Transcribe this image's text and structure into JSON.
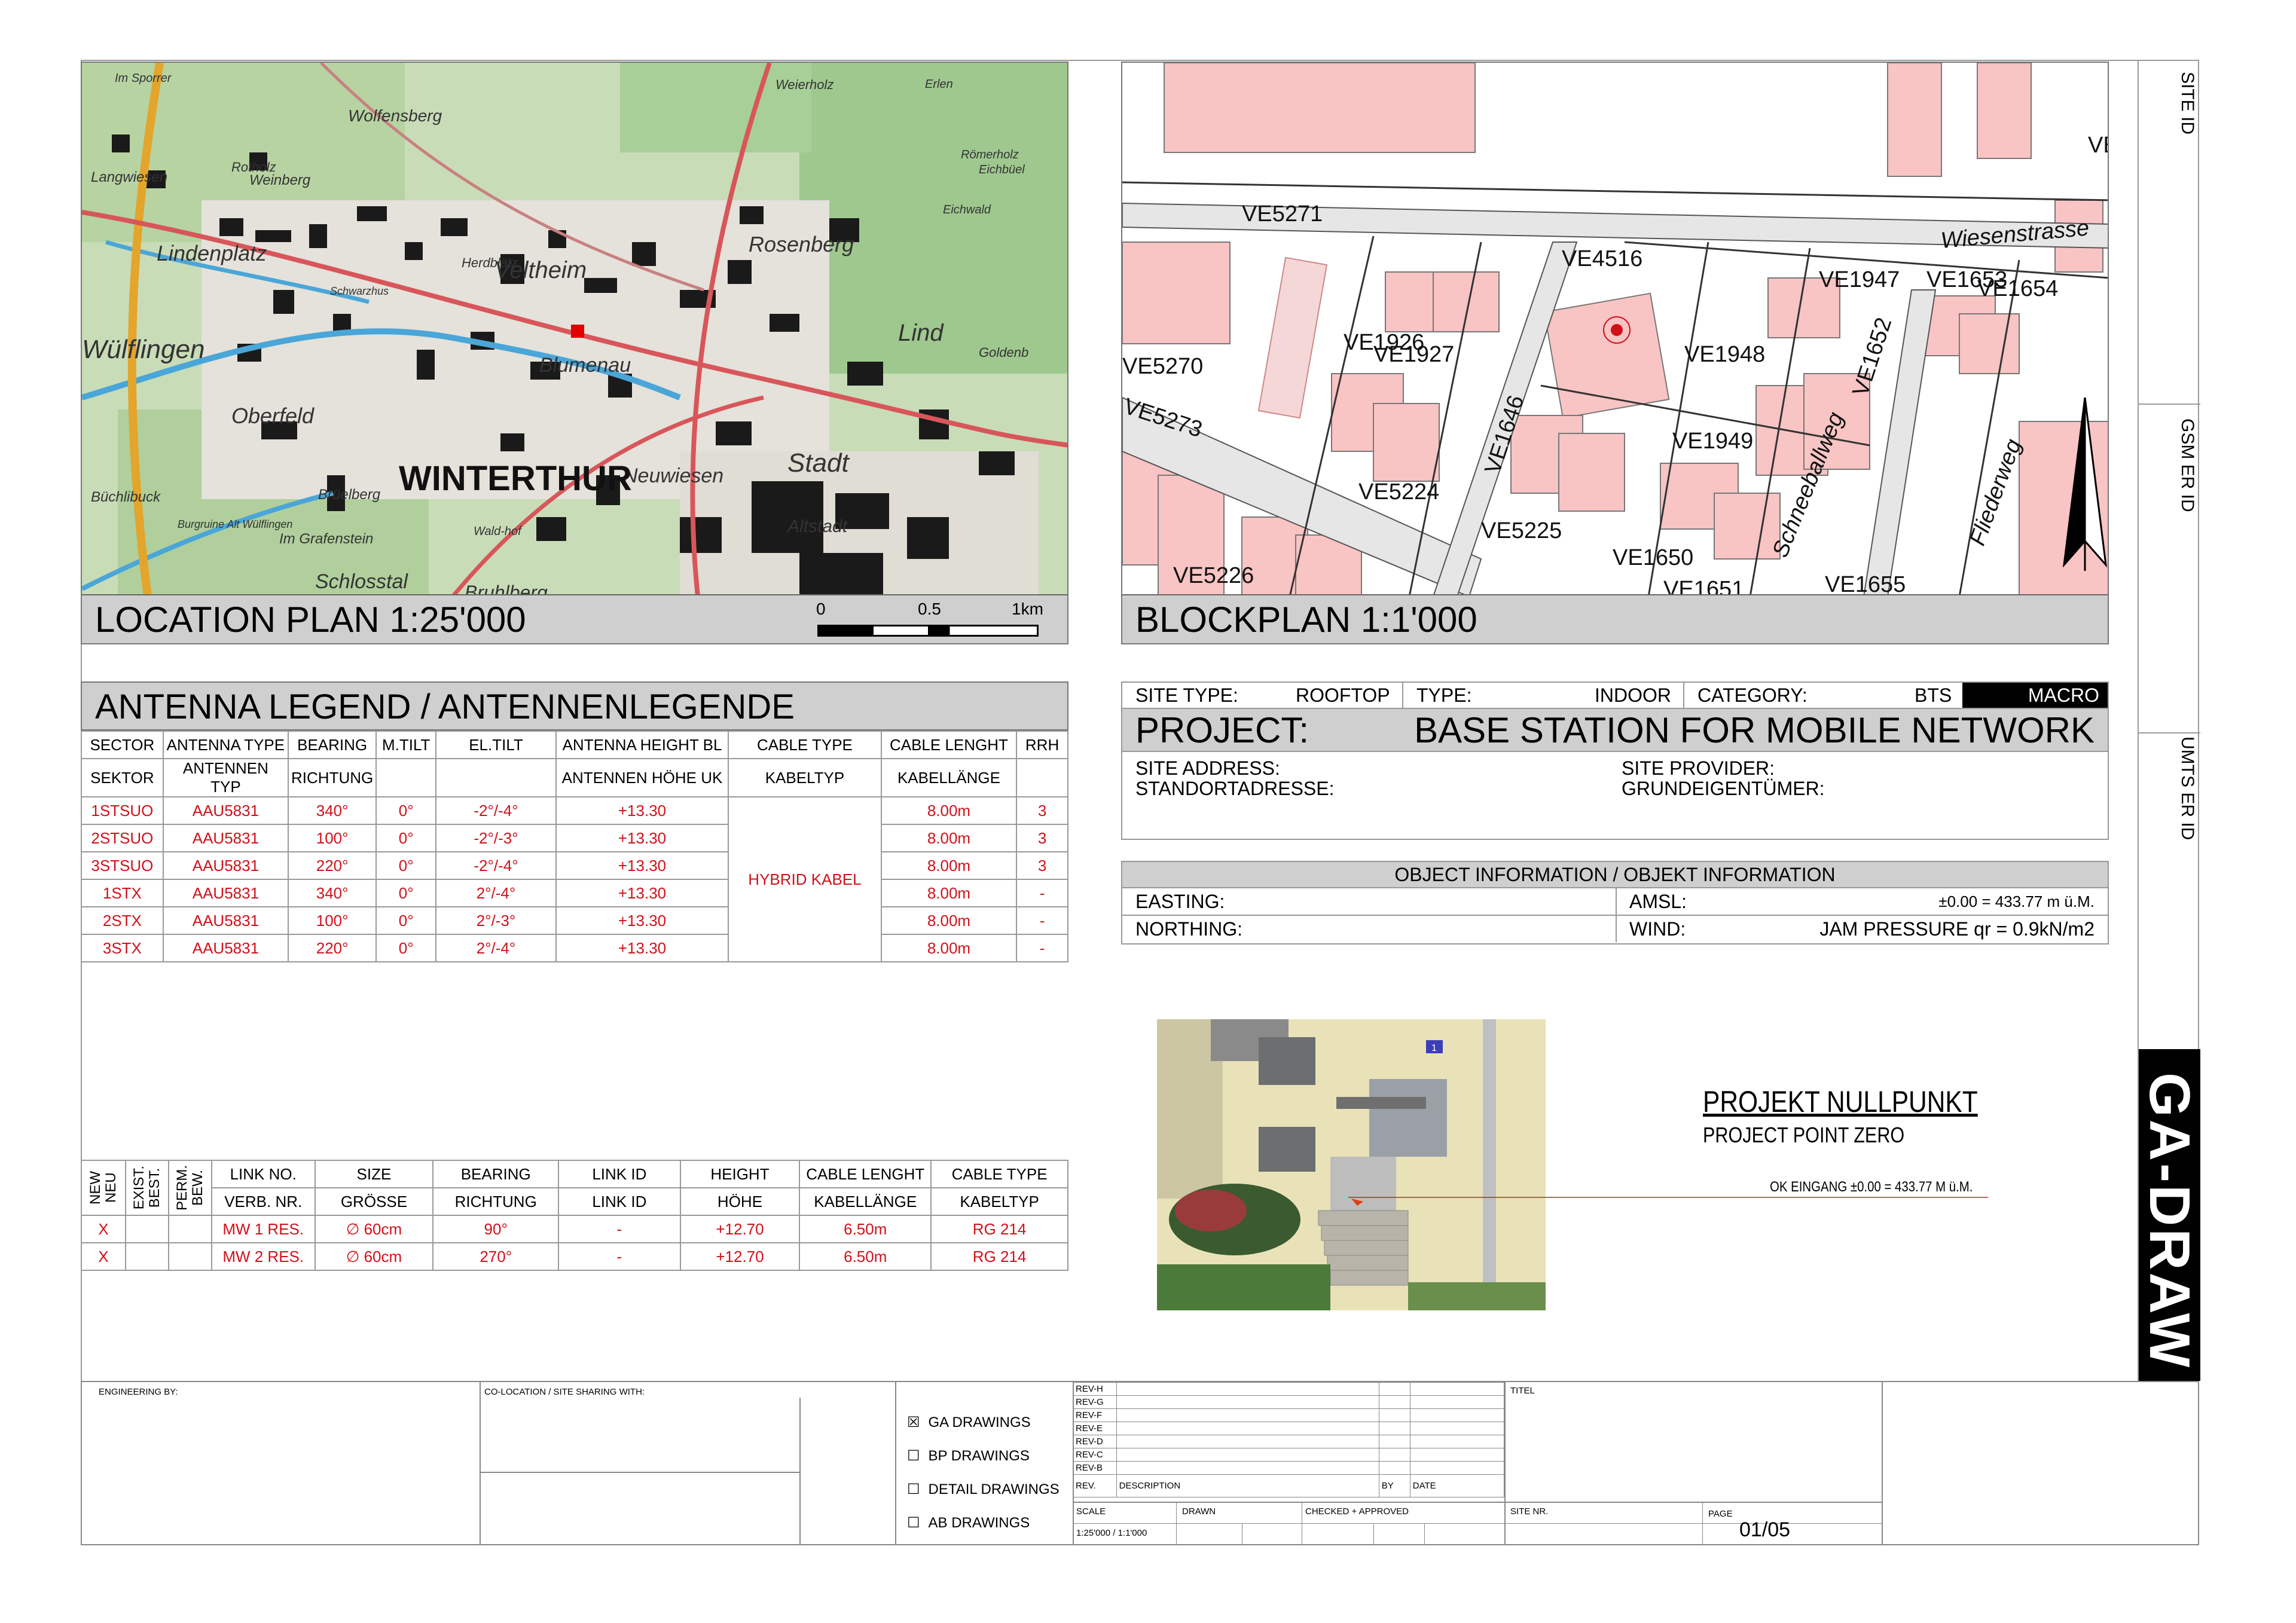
{
  "location_plan": {
    "caption": "LOCATION PLAN 1:25'000",
    "map_labels": [
      "Im Sporrer",
      "Wolfensberg",
      "Rosenberg",
      "Weierholz",
      "Erlen",
      "Langwiesen",
      "Weinberg",
      "Herdblätz",
      "Römerholz",
      "Eichbüel",
      "Lindenplatz",
      "Veltheim",
      "Lind",
      "Goldenb",
      "Wülflingen",
      "Oberfeld",
      "Blumenau",
      "Neuwiesen",
      "Stadt",
      "WINTERTHUR",
      "Büchlibuck",
      "Brüelberg",
      "Burgruine Alt Wülflingen",
      "Im Grafenstein",
      "Schlosstal",
      "Bruhlberg",
      "Altstadt",
      "Wald-hof",
      "Schwarzhus",
      "Rotholz",
      "Eichwald"
    ],
    "scale_ticks": [
      "0",
      "0.5",
      "1km"
    ]
  },
  "block_plan": {
    "caption": "BLOCKPLAN 1:1'000",
    "labels": [
      "VE5271",
      "Wiesenstrasse",
      "VE4516",
      "VE1947",
      "VE1653",
      "VE1654",
      "VE1926",
      "VE1927",
      "VE1948",
      "VE1652",
      "VE5270",
      "VE5273",
      "VE1646",
      "VE1949",
      "VE5224",
      "VE5225",
      "VE1650",
      "VE5226",
      "VE1651",
      "VE1655",
      "Schneeballweg",
      "Fliederweg",
      "VE"
    ]
  },
  "side_strip": {
    "site_id": "SITE ID",
    "gsm_er_id": "GSM ER ID",
    "umts_er_id": "UMTS ER ID",
    "brand": "GA-DRAW"
  },
  "antenna_legend": {
    "title": "ANTENNA LEGEND / ANTENNENLEGENDE",
    "headers": [
      [
        "SECTOR",
        "SEKTOR"
      ],
      [
        "ANTENNA TYPE",
        "ANTENNEN TYP"
      ],
      [
        "BEARING",
        "RICHTUNG"
      ],
      [
        "M.TILT",
        ""
      ],
      [
        "EL.TILT",
        ""
      ],
      [
        "ANTENNA HEIGHT BL",
        "ANTENNEN HÖHE UK"
      ],
      [
        "CABLE TYPE",
        "KABELTYP"
      ],
      [
        "CABLE LENGHT",
        "KABELLÄNGE"
      ],
      [
        "RRH",
        ""
      ]
    ],
    "cable_type": "HYBRID KABEL",
    "rows": [
      [
        "1STSUO",
        "AAU5831",
        "340°",
        "0°",
        "-2°/-4°",
        "+13.30",
        "8.00m",
        "3"
      ],
      [
        "2STSUO",
        "AAU5831",
        "100°",
        "0°",
        "-2°/-3°",
        "+13.30",
        "8.00m",
        "3"
      ],
      [
        "3STSUO",
        "AAU5831",
        "220°",
        "0°",
        "-2°/-4°",
        "+13.30",
        "8.00m",
        "3"
      ],
      [
        "1STX",
        "AAU5831",
        "340°",
        "0°",
        "2°/-4°",
        "+13.30",
        "8.00m",
        "-"
      ],
      [
        "2STX",
        "AAU5831",
        "100°",
        "0°",
        "2°/-3°",
        "+13.30",
        "8.00m",
        "-"
      ],
      [
        "3STX",
        "AAU5831",
        "220°",
        "0°",
        "2°/-4°",
        "+13.30",
        "8.00m",
        "-"
      ]
    ]
  },
  "link_table": {
    "vertical_headers": [
      "NEW NEU",
      "EXIST. BEST.",
      "PERM. BEW."
    ],
    "headers": [
      [
        "LINK NO.",
        "VERB. NR."
      ],
      [
        "SIZE",
        "GRÖSSE"
      ],
      [
        "BEARING",
        "RICHTUNG"
      ],
      [
        "LINK ID",
        "LINK ID"
      ],
      [
        "HEIGHT",
        "HÖHE"
      ],
      [
        "CABLE LENGHT",
        "KABELLÄNGE"
      ],
      [
        "CABLE TYPE",
        "KABELTYP"
      ]
    ],
    "rows": [
      [
        "X",
        "",
        "",
        "MW 1 RES.",
        "∅ 60cm",
        "90°",
        "-",
        "+12.70",
        "6.50m",
        "RG 214"
      ],
      [
        "X",
        "",
        "",
        "MW 2 RES.",
        "∅ 60cm",
        "270°",
        "-",
        "+12.70",
        "6.50m",
        "RG 214"
      ]
    ]
  },
  "site_info": {
    "site_type_label": "SITE TYPE:",
    "site_type": "ROOFTOP",
    "type_label": "TYPE:",
    "type": "INDOOR",
    "category_label": "CATEGORY:",
    "category": "BTS",
    "category_badge": "MACRO",
    "project_label": "PROJECT:",
    "project": "BASE STATION FOR MOBILE NETWORK",
    "site_address": "SITE ADDRESS:",
    "standortadresse": "STANDORTADRESSE:",
    "site_provider": "SITE PROVIDER:",
    "grundeigentuemer": "GRUNDEIGENTÜMER:"
  },
  "object_info": {
    "title": "OBJECT INFORMATION / OBJEKT INFORMATION",
    "easting": "EASTING:",
    "northing": "NORTHING:",
    "amsl_label": "AMSL:",
    "amsl_value": "±0.00 = 433.77 m ü.M.",
    "wind_label": "WIND:",
    "wind_value": "JAM PRESSURE qr = 0.9kN/m2"
  },
  "photo": {
    "title": "PROJEKT NULLPUNKT",
    "subtitle": "PROJECT POINT ZERO",
    "note": "OK EINGANG ±0.00 = 433.77 M ü.M.",
    "door_number": "1"
  },
  "title_block": {
    "engineering_by": "ENGINEERING BY:",
    "co_location": "CO-LOCATION / SITE SHARING WITH:",
    "drawings": [
      {
        "label": "GA DRAWINGS",
        "checked": "☒"
      },
      {
        "label": "BP DRAWINGS",
        "checked": "☐"
      },
      {
        "label": "DETAIL DRAWINGS",
        "checked": "☐"
      },
      {
        "label": "AB DRAWINGS",
        "checked": "☐"
      }
    ],
    "revs": [
      "REV-H",
      "REV-G",
      "REV-F",
      "REV-E",
      "REV-D",
      "REV-C",
      "REV-B"
    ],
    "rev_header": {
      "rev": "REV.",
      "description": "DESCRIPTION",
      "by": "BY",
      "date": "DATE"
    },
    "titel": "TITEL",
    "scale_label": "SCALE",
    "scale_value": "1:25'000 / 1:1'000",
    "drawn": "DRAWN",
    "checked_approved": "CHECKED + APPROVED",
    "site_nr": "SITE NR.",
    "page_label": "PAGE",
    "page_value": "01/05"
  }
}
